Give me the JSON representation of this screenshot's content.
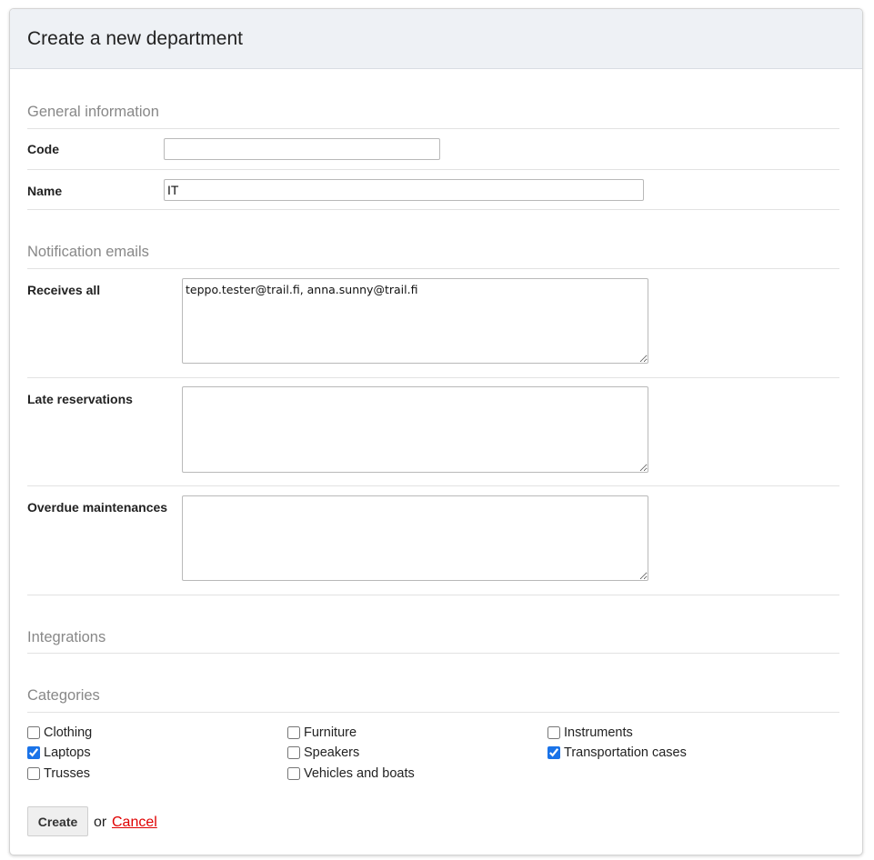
{
  "header": {
    "title": "Create a new department"
  },
  "general": {
    "title": "General information",
    "code_label": "Code",
    "code_value": "",
    "name_label": "Name",
    "name_value": "IT"
  },
  "notifications": {
    "title": "Notification emails",
    "receives_all_label": "Receives all",
    "receives_all_value": "teppo.tester@trail.fi, anna.sunny@trail.fi",
    "late_reservations_label": "Late reservations",
    "late_reservations_value": "",
    "overdue_maintenances_label": "Overdue maintenances",
    "overdue_maintenances_value": ""
  },
  "integrations": {
    "title": "Integrations"
  },
  "categories": {
    "title": "Categories",
    "items": [
      {
        "label": "Clothing",
        "checked": false
      },
      {
        "label": "Furniture",
        "checked": false
      },
      {
        "label": "Instruments",
        "checked": false
      },
      {
        "label": "Laptops",
        "checked": true
      },
      {
        "label": "Speakers",
        "checked": false
      },
      {
        "label": "Transportation cases",
        "checked": true
      },
      {
        "label": "Trusses",
        "checked": false
      },
      {
        "label": "Vehicles and boats",
        "checked": false
      }
    ]
  },
  "actions": {
    "create_label": "Create",
    "or_text": "or",
    "cancel_label": "Cancel"
  },
  "colors": {
    "header_bg": "#eef1f5",
    "section_title": "#888888",
    "cancel_link": "#e00000",
    "checkbox_accent": "#1a73e8"
  }
}
